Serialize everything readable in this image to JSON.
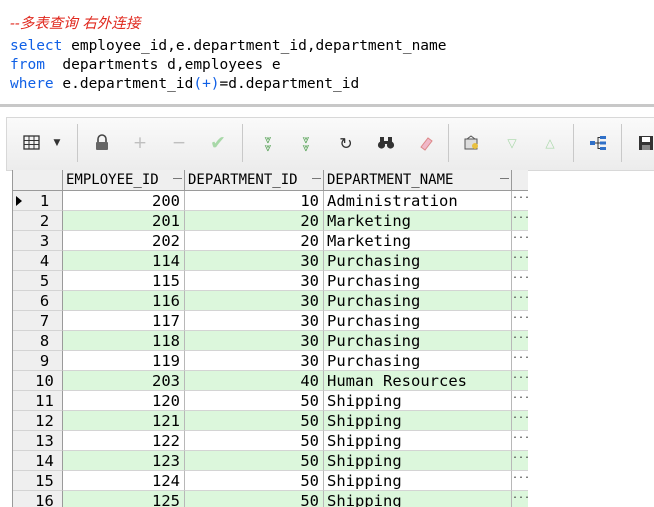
{
  "editor": {
    "comment": "--多表查询 右外连接",
    "line2_kw": "select",
    "line2_rest": " employee_id,e.department_id,department_name",
    "line3_kw": "from",
    "line3_rest": "  departments d,employees e",
    "line4_kw": "where",
    "line4_a": " e.department_id",
    "line4_plus": "(+)",
    "line4_b": "=d.department_id"
  },
  "toolbar": {
    "icons": [
      "grid-menu-icon",
      "lock-icon",
      "plus-icon",
      "minus-icon",
      "check-icon",
      "double-down-icon",
      "double-down-alt-icon",
      "refresh-icon",
      "binoculars-icon",
      "eraser-icon",
      "query-icon",
      "triangle-down-icon",
      "triangle-up-icon",
      "tree-icon",
      "save-icon"
    ]
  },
  "grid": {
    "columns": [
      "EMPLOYEE_ID",
      "DEPARTMENT_ID",
      "DEPARTMENT_NAME"
    ],
    "ellipsis": "...",
    "rows": [
      {
        "n": "1",
        "emp": "200",
        "dept": "10",
        "name": "Administration"
      },
      {
        "n": "2",
        "emp": "201",
        "dept": "20",
        "name": "Marketing"
      },
      {
        "n": "3",
        "emp": "202",
        "dept": "20",
        "name": "Marketing"
      },
      {
        "n": "4",
        "emp": "114",
        "dept": "30",
        "name": "Purchasing"
      },
      {
        "n": "5",
        "emp": "115",
        "dept": "30",
        "name": "Purchasing"
      },
      {
        "n": "6",
        "emp": "116",
        "dept": "30",
        "name": "Purchasing"
      },
      {
        "n": "7",
        "emp": "117",
        "dept": "30",
        "name": "Purchasing"
      },
      {
        "n": "8",
        "emp": "118",
        "dept": "30",
        "name": "Purchasing"
      },
      {
        "n": "9",
        "emp": "119",
        "dept": "30",
        "name": "Purchasing"
      },
      {
        "n": "10",
        "emp": "203",
        "dept": "40",
        "name": "Human Resources"
      },
      {
        "n": "11",
        "emp": "120",
        "dept": "50",
        "name": "Shipping"
      },
      {
        "n": "12",
        "emp": "121",
        "dept": "50",
        "name": "Shipping"
      },
      {
        "n": "13",
        "emp": "122",
        "dept": "50",
        "name": "Shipping"
      },
      {
        "n": "14",
        "emp": "123",
        "dept": "50",
        "name": "Shipping"
      },
      {
        "n": "15",
        "emp": "124",
        "dept": "50",
        "name": "Shipping"
      },
      {
        "n": "16",
        "emp": "125",
        "dept": "50",
        "name": "Shipping"
      }
    ]
  },
  "colors": {
    "keyword": "#1060e6",
    "comment": "#e0281e",
    "alt_row": "#dcf7dc"
  }
}
